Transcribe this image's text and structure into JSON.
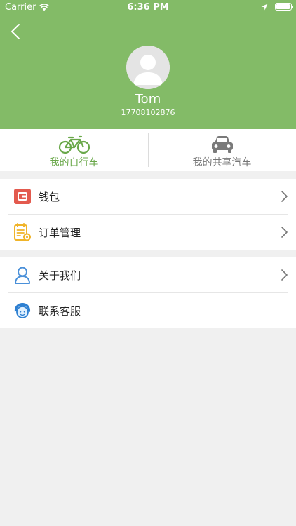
{
  "status_bar": {
    "carrier": "Carrier",
    "time": "6:36 PM",
    "battery_level": 0.95
  },
  "profile": {
    "name": "Tom",
    "phone": "17708102876"
  },
  "tabs": [
    {
      "label": "我的自行车",
      "active": true,
      "icon": "bicycle-icon"
    },
    {
      "label": "我的共享汽车",
      "active": false,
      "icon": "car-icon"
    }
  ],
  "menu": {
    "group1": [
      {
        "label": "钱包",
        "icon": "wallet-icon"
      },
      {
        "label": "订单管理",
        "icon": "order-management-icon"
      }
    ],
    "group2": [
      {
        "label": "关于我们",
        "icon": "person-outline-icon"
      },
      {
        "label": "联系客服",
        "icon": "customer-service-icon"
      }
    ]
  },
  "colors": {
    "header": "#83bb67",
    "active_tab": "#6aa84a",
    "inactive_tab": "#777777",
    "background": "#f0f0f0"
  }
}
